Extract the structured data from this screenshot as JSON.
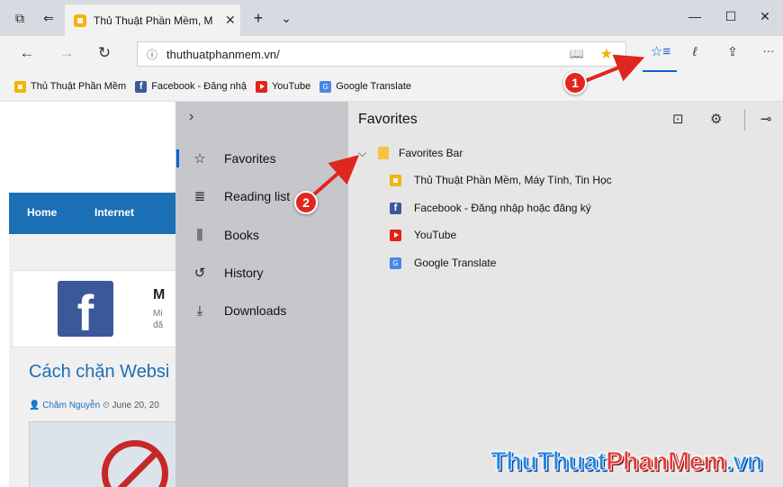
{
  "titlebar": {
    "tab_title": "Thủ Thuật Phần Mềm, M",
    "tab_close": "✕",
    "new_tab": "+",
    "tab_list": "⌄",
    "minimize": "—",
    "maximize": "☐",
    "close": "✕"
  },
  "navbar": {
    "back": "←",
    "forward": "→",
    "refresh": "↻",
    "info": "ⓘ",
    "url": "thuthuatphanmem.vn/",
    "more": "···"
  },
  "favorites_bar": [
    {
      "label": "Thủ Thuật Phần Mềm",
      "icon": "thuthuat-icon"
    },
    {
      "label": "Facebook - Đăng nhậ",
      "icon": "facebook-icon"
    },
    {
      "label": "YouTube",
      "icon": "youtube-icon"
    },
    {
      "label": "Google Translate",
      "icon": "google-translate-icon"
    }
  ],
  "page": {
    "nav_home": "Home",
    "nav_internet": "Internet",
    "card_heading": "M",
    "card_text1": "Mi",
    "card_text2": "đă",
    "article_title": "Cách chặn Websi",
    "author": "Chăm Nguyễn",
    "date": "June 20, 20"
  },
  "hub": {
    "menu": [
      {
        "label": "Favorites",
        "icon": "star-icon"
      },
      {
        "label": "Reading list",
        "icon": "reading-list-icon"
      },
      {
        "label": "Books",
        "icon": "books-icon"
      },
      {
        "label": "History",
        "icon": "history-icon"
      },
      {
        "label": "Downloads",
        "icon": "downloads-icon"
      }
    ],
    "panel_title": "Favorites",
    "folder": "Favorites Bar",
    "items": [
      {
        "label": "Thủ Thuật Phần Mềm, Máy Tính, Tin Học",
        "icon": "thuthuat-icon"
      },
      {
        "label": "Facebook - Đăng nhập hoặc đăng ký",
        "icon": "facebook-icon"
      },
      {
        "label": "YouTube",
        "icon": "youtube-icon"
      },
      {
        "label": "Google Translate",
        "icon": "google-translate-icon"
      }
    ]
  },
  "annotations": {
    "step1": "1",
    "step2": "2"
  },
  "watermark": {
    "part1": "ThuThuat",
    "part2": "PhanMem",
    "part3": ".vn"
  },
  "colors": {
    "accent": "#0a63c9",
    "badge": "#e0271f",
    "site_blue": "#1b6fb5"
  }
}
